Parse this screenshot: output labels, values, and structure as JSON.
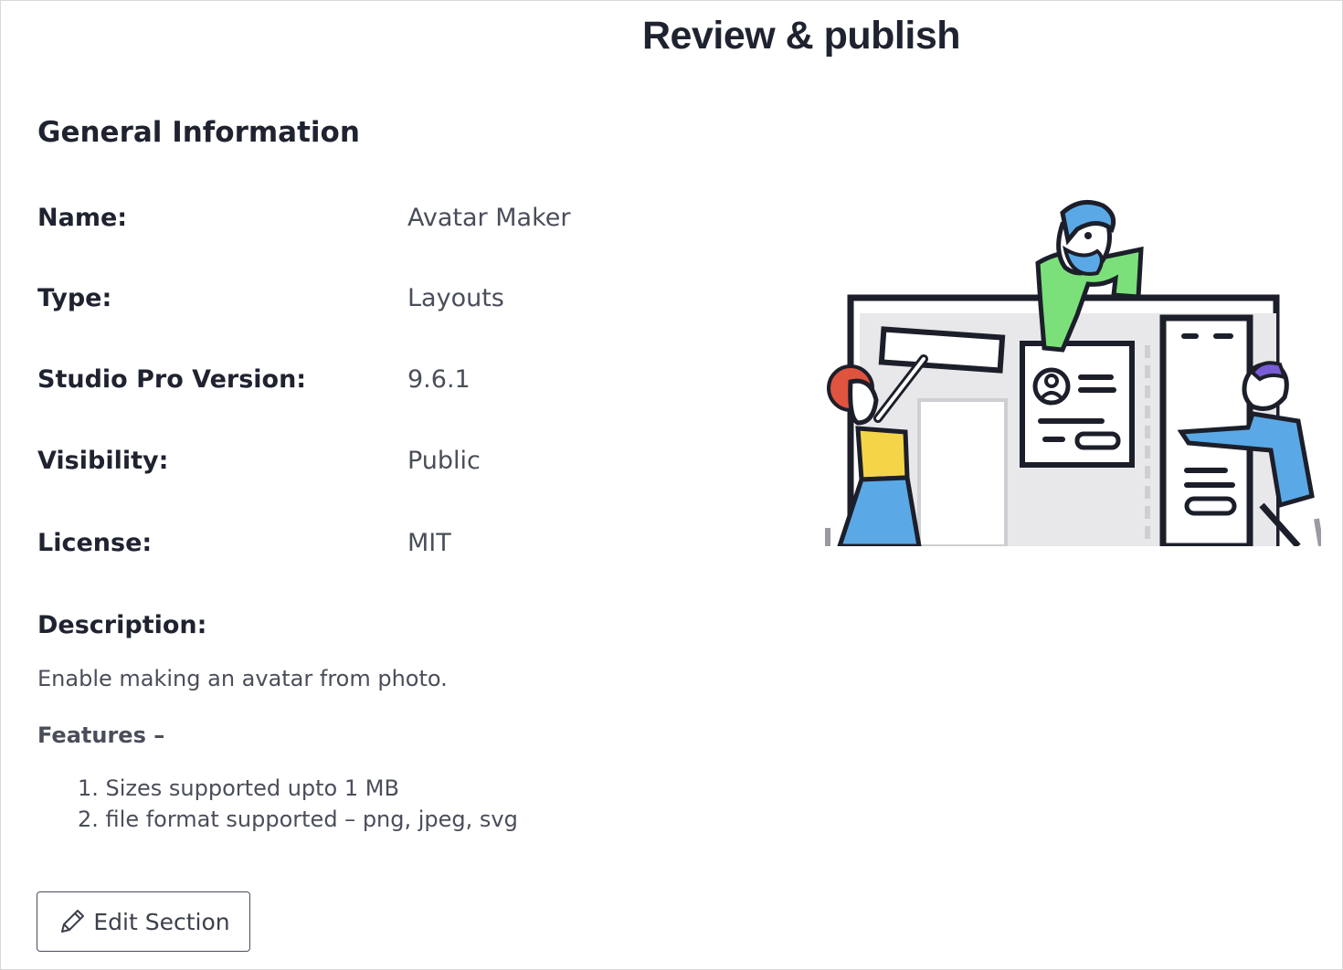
{
  "page": {
    "title": "Review & publish"
  },
  "general_information": {
    "heading": "General Information",
    "fields": [
      {
        "label": "Name:",
        "value": "Avatar Maker"
      },
      {
        "label": "Type:",
        "value": "Layouts"
      },
      {
        "label": "Studio Pro Version:",
        "value": "9.6.1"
      },
      {
        "label": "Visibility:",
        "value": "Public"
      },
      {
        "label": "License:",
        "value": "MIT"
      }
    ],
    "description_label": "Description:",
    "description_text": "Enable making an avatar from photo.",
    "features_title": "Features –",
    "features": [
      "1. Sizes supported upto 1 MB",
      "2. file format supported – png, jpeg, svg"
    ]
  },
  "actions": {
    "edit_section_label": "Edit Section",
    "edit_icon": "pencil-icon"
  },
  "illustration": {
    "subject": "team-building-web-page-illustration"
  },
  "colors": {
    "heading": "#1f2330",
    "value_text": "#4a4e5a",
    "green_shirt": "#7be07a",
    "blue_shirt": "#5aa9e6",
    "yellow_top": "#f4d548",
    "red_hair": "#e0533f"
  }
}
